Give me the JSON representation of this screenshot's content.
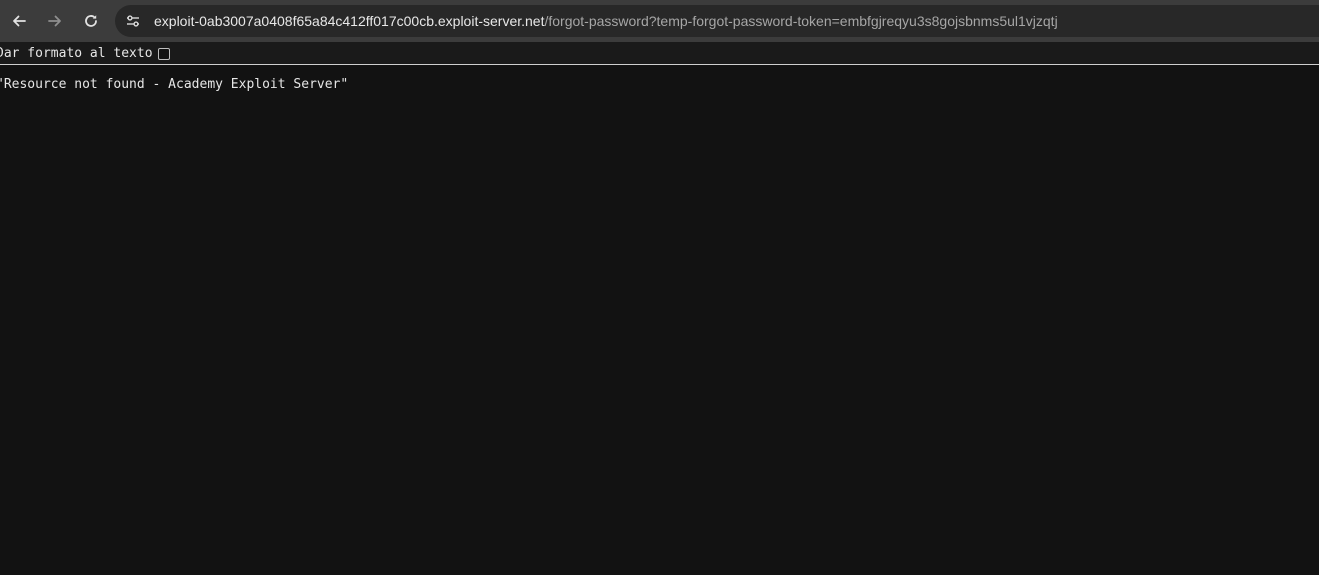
{
  "browser": {
    "back_icon": "arrow-left-icon",
    "forward_icon": "arrow-right-icon",
    "reload_icon": "reload-icon",
    "site_info_icon": "tune-icon",
    "url_host": "exploit-0ab3007a0408f65a84c412ff017c00cb.exploit-server.net",
    "url_path": "/forgot-password?temp-forgot-password-token=embfgjreqyu3s8gojsbnms5ul1vjzqtj"
  },
  "pretty_print": {
    "label": "Dar formato al texto",
    "checked": false
  },
  "content": {
    "text": "\"Resource not found - Academy Exploit Server\""
  }
}
